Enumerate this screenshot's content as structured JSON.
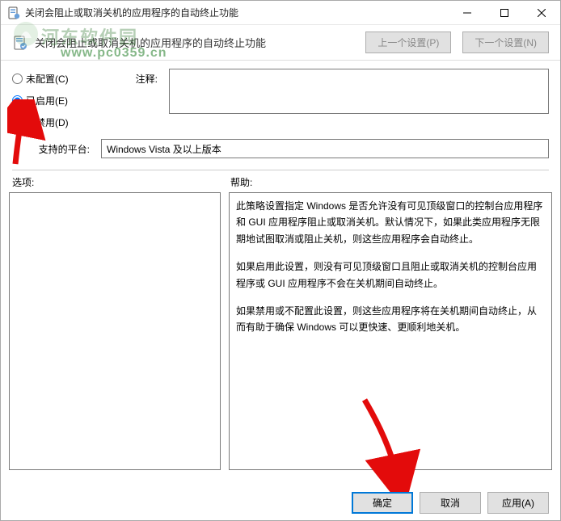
{
  "window": {
    "title": "关闭会阻止或取消关机的应用程序的自动终止功能",
    "subtitle": "关闭会阻止或取消关机的应用程序的自动终止功能"
  },
  "nav": {
    "prev": "上一个设置(P)",
    "next": "下一个设置(N)"
  },
  "radios": {
    "unconfigured": "未配置(C)",
    "enabled": "已启用(E)",
    "disabled": "已禁用(D)"
  },
  "labels": {
    "annotation": "注释:",
    "platform": "支持的平台:",
    "options": "选项:",
    "help": "帮助:"
  },
  "fields": {
    "annotation_value": "",
    "platform_value": "Windows Vista 及以上版本"
  },
  "help": {
    "p1": "此策略设置指定 Windows 是否允许没有可见顶级窗口的控制台应用程序和 GUI 应用程序阻止或取消关机。默认情况下，如果此类应用程序无限期地试图取消或阻止关机，则这些应用程序会自动终止。",
    "p2": "如果启用此设置，则没有可见顶级窗口且阻止或取消关机的控制台应用程序或 GUI 应用程序不会在关机期间自动终止。",
    "p3": "如果禁用或不配置此设置，则这些应用程序将在关机期间自动终止，从而有助于确保 Windows 可以更快速、更顺利地关机。"
  },
  "footer": {
    "ok": "确定",
    "cancel": "取消",
    "apply": "应用(A)"
  },
  "watermark": {
    "text1": "河东软件园",
    "text2": "www.pc0359.cn"
  }
}
